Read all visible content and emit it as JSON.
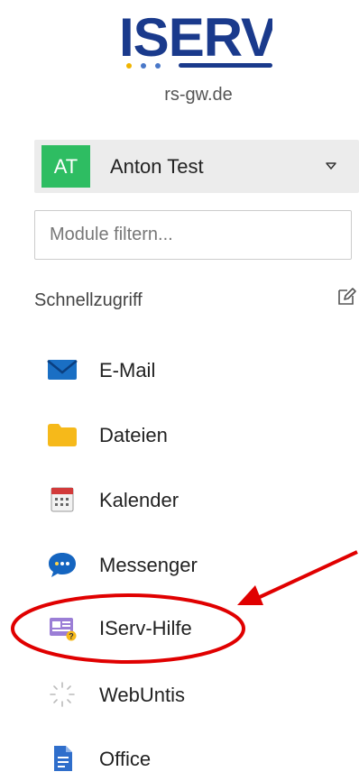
{
  "logo": {
    "text": "ISERV"
  },
  "domain": "rs-gw.de",
  "user": {
    "initials": "AT",
    "name": "Anton Test"
  },
  "filter": {
    "placeholder": "Module filtern..."
  },
  "quick_access": {
    "title": "Schnellzugriff",
    "items": [
      {
        "label": "E-Mail",
        "icon": "mail-icon"
      },
      {
        "label": "Dateien",
        "icon": "folder-icon"
      },
      {
        "label": "Kalender",
        "icon": "calendar-icon"
      },
      {
        "label": "Messenger",
        "icon": "chat-icon"
      },
      {
        "label": "IServ-Hilfe",
        "icon": "help-icon"
      },
      {
        "label": "WebUntis",
        "icon": "loading-spinner-icon"
      },
      {
        "label": "Office",
        "icon": "document-icon"
      }
    ]
  },
  "colors": {
    "brand": "#1a3a8c",
    "avatar": "#2ebd62",
    "annotation": "#e00000"
  }
}
